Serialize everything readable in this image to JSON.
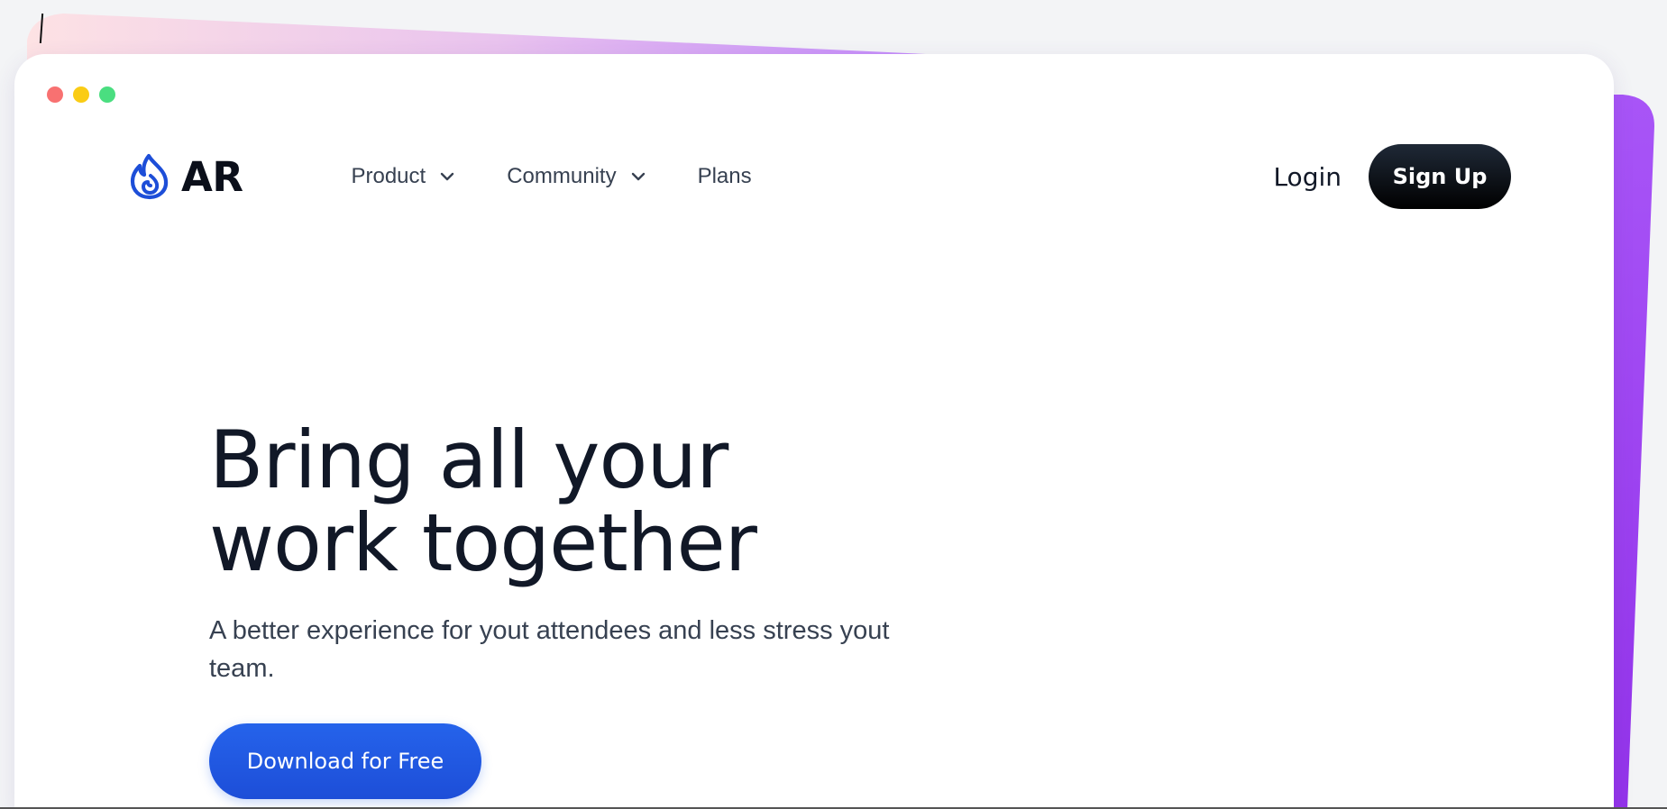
{
  "colors": {
    "accent": "#2563eb",
    "decor_purple": "#a855f7",
    "decor_pink": "#fbcfe8",
    "dot_red": "#f87171",
    "dot_yellow": "#facc15",
    "dot_green": "#4ade80"
  },
  "window": {
    "controls": [
      "close",
      "minimize",
      "maximize"
    ]
  },
  "nav": {
    "logo_icon": "flame-icon",
    "logo_text": "AR",
    "links": [
      {
        "label": "Product",
        "has_dropdown": true
      },
      {
        "label": "Community",
        "has_dropdown": true
      },
      {
        "label": "Plans",
        "has_dropdown": false
      }
    ],
    "login_label": "Login",
    "signup_label": "Sign Up"
  },
  "hero": {
    "title_line1": "Bring all your",
    "title_line2": "work together",
    "subtitle": "A better experience for yout attendees and less stress yout team.",
    "cta_label": "Download for Free"
  }
}
